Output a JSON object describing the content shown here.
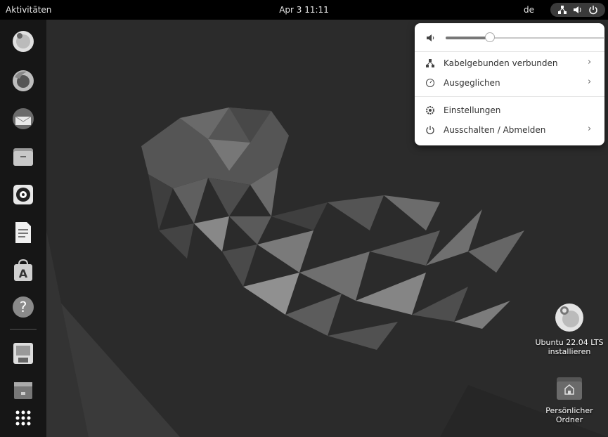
{
  "topbar": {
    "activities": "Aktivitäten",
    "clock": "Apr 3  11:11",
    "keyboard_layout": "de",
    "status_icons": [
      "network-icon",
      "speaker-icon",
      "power-icon"
    ]
  },
  "dock": {
    "items": [
      {
        "name": "ubuntu-installer",
        "icon": "installer-icon"
      },
      {
        "name": "firefox",
        "icon": "firefox-icon"
      },
      {
        "name": "thunderbird",
        "icon": "thunderbird-icon"
      },
      {
        "name": "files",
        "icon": "folder-icon"
      },
      {
        "name": "rhythmbox",
        "icon": "rhythmbox-icon"
      },
      {
        "name": "libreoffice-writer",
        "icon": "writer-icon"
      },
      {
        "name": "software",
        "icon": "software-bag-icon"
      },
      {
        "name": "help",
        "icon": "help-icon"
      },
      {
        "name": "save-drive",
        "icon": "floppy-icon"
      },
      {
        "name": "drive",
        "icon": "drive-icon"
      },
      {
        "name": "show-apps",
        "icon": "app-grid-icon"
      }
    ]
  },
  "desktop": {
    "icons": [
      {
        "label_line1": "Ubuntu 22.04 LTS",
        "label_line2": "installieren",
        "icon": "installer-icon"
      },
      {
        "label_line1": "Persönlicher",
        "label_line2": "Ordner",
        "icon": "home-folder-icon"
      }
    ]
  },
  "quick_menu": {
    "volume_percent": 28,
    "items": [
      {
        "label": "Kabelgebunden verbunden",
        "icon": "network-icon",
        "has_submenu": true
      },
      {
        "label": "Ausgeglichen",
        "icon": "power-profile-icon",
        "has_submenu": true
      },
      {
        "label": "Einstellungen",
        "icon": "settings-gear-icon",
        "has_submenu": false
      },
      {
        "label": "Ausschalten / Abmelden",
        "icon": "power-icon",
        "has_submenu": true
      }
    ],
    "chevron": "›"
  },
  "colors": {
    "topbar": "#000000",
    "dock": "#161616",
    "menu_bg": "#ffffff",
    "wallpaper": "#2a2a2a"
  }
}
